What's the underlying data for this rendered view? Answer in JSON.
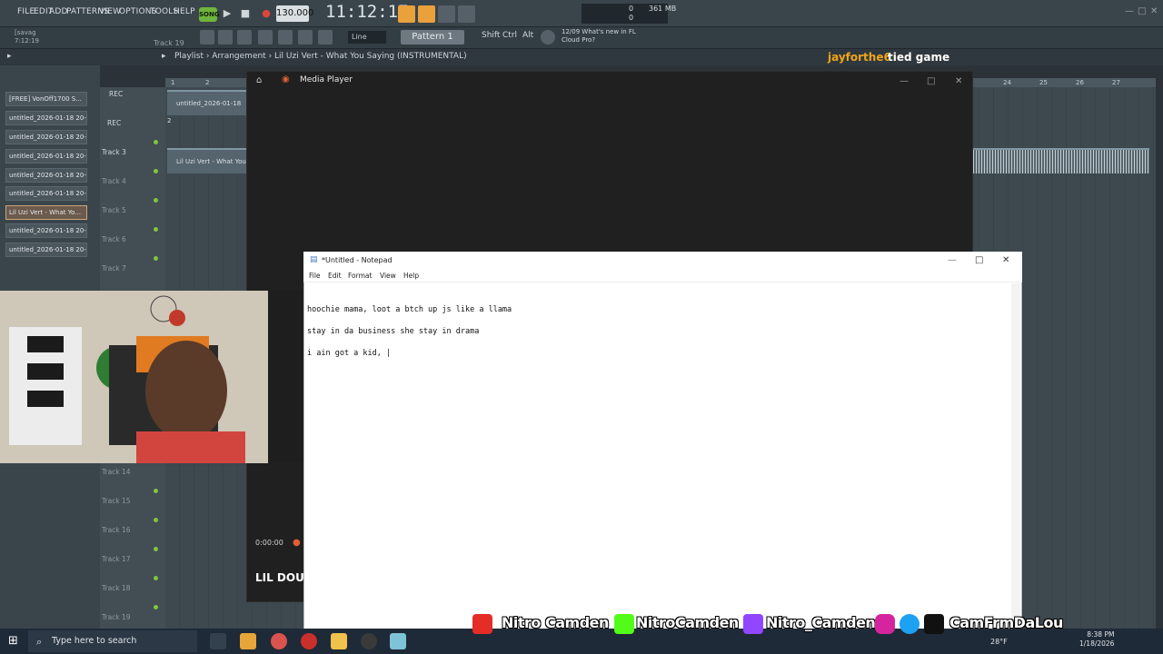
{
  "fl_menu": [
    "FILE",
    "EDIT",
    "ADD",
    "PATTERNS",
    "VIEW",
    "OPTIONS",
    "TOOLS",
    "HELP"
  ],
  "fl_song_mode": "SONG",
  "fl_tempo": "130.000",
  "fl_clock": "11:12:17",
  "fl_meter": {
    "left": "0",
    "left2": "0",
    "mem": "361 MB"
  },
  "fl_hint": {
    "line1": "[savag",
    "line2": "7:12:19",
    "track": "Track 19"
  },
  "fl_toolbar2": {
    "line_mode": "Line",
    "pattern": "Pattern 1",
    "shift": "Shift",
    "ctrl": "Ctrl",
    "alt": "Alt",
    "news_date": "12/09",
    "news_line1": "What's new in FL",
    "news_line2": "Cloud Pro?"
  },
  "playlist": {
    "breadcrumb": "Playlist › Arrangement › Lil Uzi Vert - What You Saying (INSTRUMENTAL)"
  },
  "project": {
    "user": "jayforthe6",
    "title": "tied game"
  },
  "browser_items": [
    "[FREE] VonOff1700 S...",
    "untitled_2026-01-18 20-...",
    "untitled_2026-01-18 20-...",
    "untitled_2026-01-18 20-...",
    "untitled_2026-01-18 20-...",
    "untitled_2026-01-18 20-...",
    "Lil Uzi Vert - What Yo...",
    "untitled_2026-01-18 20-...",
    "untitled_2026-01-18 20-..."
  ],
  "tracks": {
    "rec": "REC",
    "rec2": "REC",
    "t3": "Track 3",
    "t4": "Track 4",
    "t5": "Track 5",
    "t6": "Track 6",
    "t7": "Track 7",
    "t14": "Track 14",
    "t15": "Track 15",
    "t16": "Track 16",
    "t17": "Track 17",
    "t18": "Track 18",
    "t19": "Track 19"
  },
  "clips": {
    "clip1": "untitled_2026-01-18 2",
    "clip2": "Lil Uzi Vert - What You"
  },
  "ruler": {
    "r1": "1",
    "r2": "2",
    "r24": "24",
    "r25": "25",
    "r26": "26",
    "r27": "27"
  },
  "media_player": {
    "title": "Media Player",
    "time": "0:00:00",
    "now_playing": "LIL DOUE"
  },
  "notepad": {
    "title": "*Untitled - Notepad",
    "menu": [
      "File",
      "Edit",
      "Format",
      "View",
      "Help"
    ],
    "lines": [
      "hoochie mama, loot a btch up js like a llama",
      "stay in da business she stay in drama",
      "i ain got a kid, |"
    ]
  },
  "socials": {
    "youtube": "Nitro Camden",
    "kick": "NitroCamden",
    "twitch": "Nitro_Camden",
    "social": "CamFrmDaLou"
  },
  "taskbar": {
    "search_placeholder": "Type here to search",
    "temp": "28°F",
    "time": "8:38 PM",
    "date": "1/18/2026"
  }
}
